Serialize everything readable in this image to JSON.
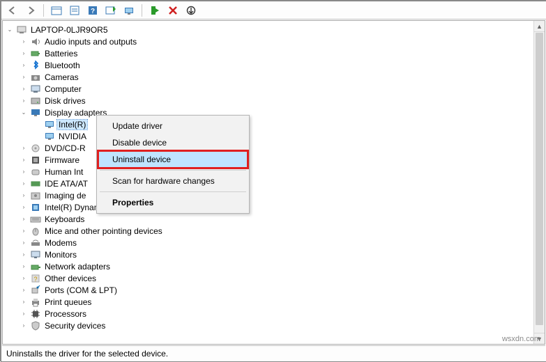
{
  "root": {
    "label": "LAPTOP-0LJR9OR5"
  },
  "categories": [
    {
      "label": "Audio inputs and outputs",
      "expanded": false
    },
    {
      "label": "Batteries",
      "expanded": false
    },
    {
      "label": "Bluetooth",
      "expanded": false
    },
    {
      "label": "Cameras",
      "expanded": false
    },
    {
      "label": "Computer",
      "expanded": false
    },
    {
      "label": "Disk drives",
      "expanded": false
    },
    {
      "label": "Display adapters",
      "expanded": true,
      "children": [
        {
          "label": "Intel(R)",
          "selected": true
        },
        {
          "label": "NVIDIA"
        }
      ]
    },
    {
      "label": "DVD/CD-R",
      "expanded": false
    },
    {
      "label": "Firmware",
      "expanded": false
    },
    {
      "label": "Human Int",
      "expanded": false
    },
    {
      "label": "IDE ATA/AT",
      "expanded": false
    },
    {
      "label": "Imaging de",
      "expanded": false
    },
    {
      "label": "Intel(R) Dynamic Platform and Thermal Framework",
      "expanded": false
    },
    {
      "label": "Keyboards",
      "expanded": false
    },
    {
      "label": "Mice and other pointing devices",
      "expanded": false
    },
    {
      "label": "Modems",
      "expanded": false
    },
    {
      "label": "Monitors",
      "expanded": false
    },
    {
      "label": "Network adapters",
      "expanded": false
    },
    {
      "label": "Other devices",
      "expanded": false
    },
    {
      "label": "Ports (COM & LPT)",
      "expanded": false
    },
    {
      "label": "Print queues",
      "expanded": false
    },
    {
      "label": "Processors",
      "expanded": false
    },
    {
      "label": "Security devices",
      "expanded": false
    }
  ],
  "context_menu": {
    "update": "Update driver",
    "disable": "Disable device",
    "uninstall": "Uninstall device",
    "scan": "Scan for hardware changes",
    "properties": "Properties"
  },
  "status": "Uninstalls the driver for the selected device.",
  "watermark": "wsxdn.com"
}
